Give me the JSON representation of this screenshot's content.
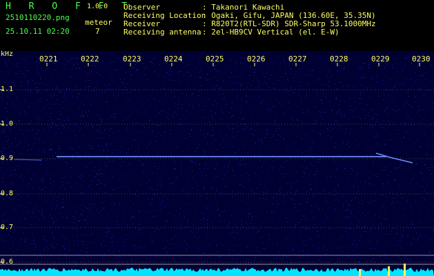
{
  "app": {
    "name": "H R O F F T",
    "version": "1.0.0"
  },
  "file": {
    "name": "2510110220.png",
    "timestamp": "25.10.11 02:20"
  },
  "meteor": {
    "label": "meteor",
    "count": "7"
  },
  "station": {
    "rows": [
      {
        "key": "Observer",
        "value": ": Takanori Kawachi"
      },
      {
        "key": "Receiving Location",
        "value": ": Ogaki, Gifu, JAPAN (136.60E, 35.35N)"
      },
      {
        "key": "Receiver",
        "value": ": R820T2(RTL-SDR) SDR-Sharp 53.1000MHz"
      },
      {
        "key": "Receiving antenna",
        "value": ": 2el-HB9CV Vertical (el. E-W)"
      }
    ]
  },
  "spectrogram": {
    "y_unit": "kHz",
    "y_ticks": [
      "1.1",
      "1.0",
      "0.9",
      "0.8",
      "0.7",
      "0.6"
    ],
    "x_ticks": [
      "0221",
      "0222",
      "0223",
      "0224",
      "0225",
      "0226",
      "0227",
      "0228",
      "0229",
      "0230"
    ],
    "colors": {
      "background": "#000033",
      "noise": "#2222aa",
      "signal": "#6f8cff",
      "grid": "#ffff66",
      "level": "#00e5ff"
    }
  }
}
